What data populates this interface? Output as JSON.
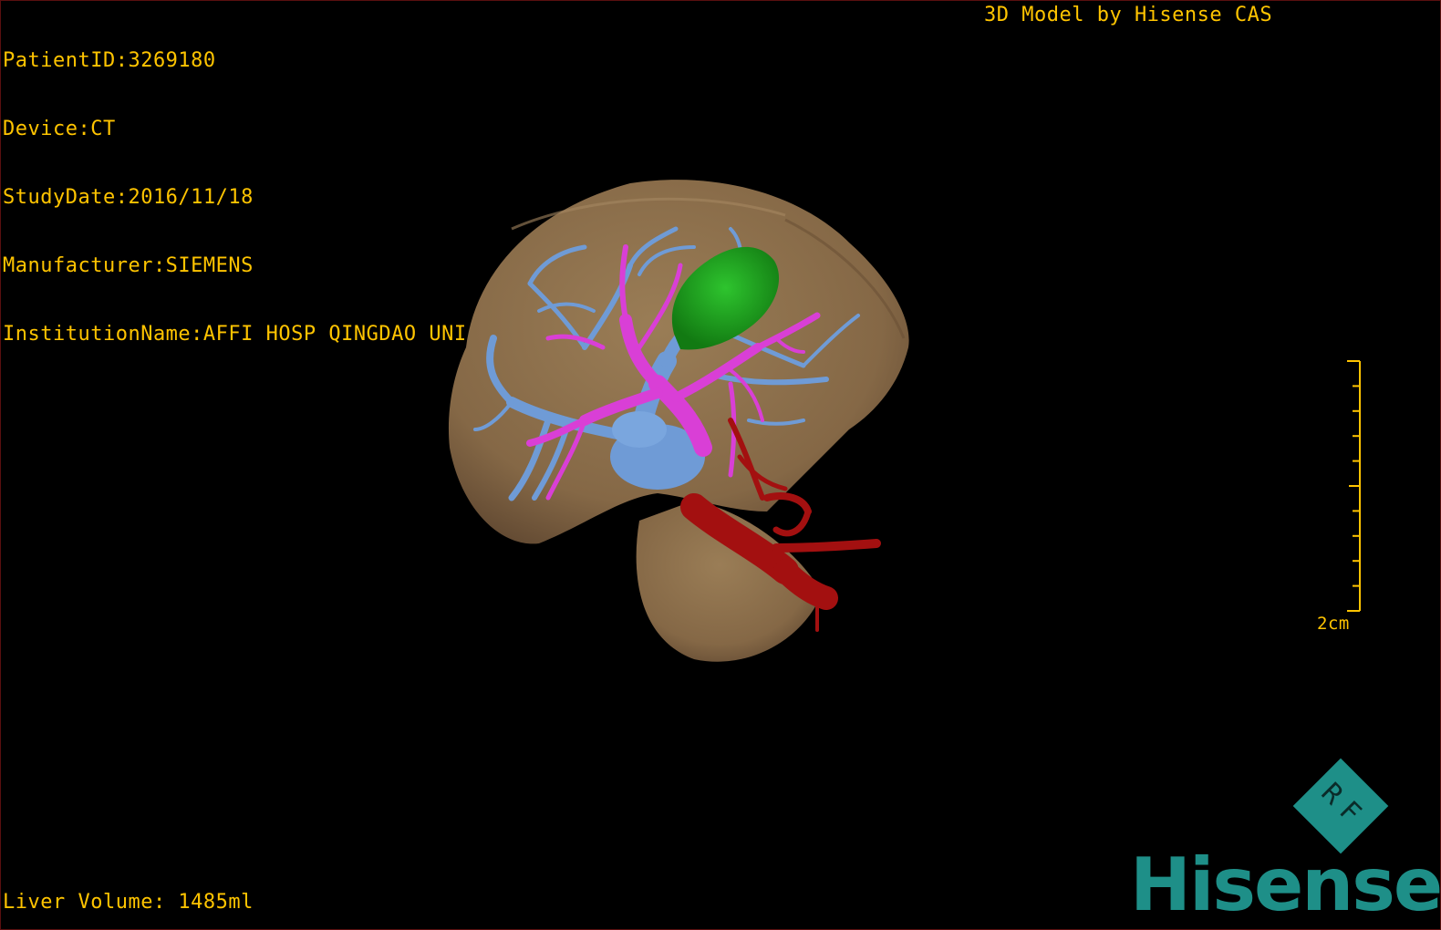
{
  "meta": {
    "patient_id": "PatientID:3269180",
    "device": "Device:CT",
    "study_date": "StudyDate:2016/11/18",
    "manufacturer": "Manufacturer:SIEMENS",
    "institution": "InstitutionName:AFFI HOSP QINGDAO UNI"
  },
  "header": {
    "title": "3D Model by Hisense CAS"
  },
  "footer": {
    "liver_volume": "Liver Volume: 1485ml"
  },
  "scale_bar": {
    "label": "2cm"
  },
  "logo": {
    "brand": "Hisense",
    "badge": "RF"
  },
  "colors": {
    "overlay_text": "#ffc400",
    "liver": "#8b6f4c",
    "portal_vein": "#6f9bd6",
    "hepatic_vein": "#d93fd6",
    "artery": "#a31010",
    "lesion": "#1aa01a",
    "brand": "#1e8f88"
  },
  "icons": [
    "orientation-cube-icon",
    "scale-bar-icon"
  ]
}
